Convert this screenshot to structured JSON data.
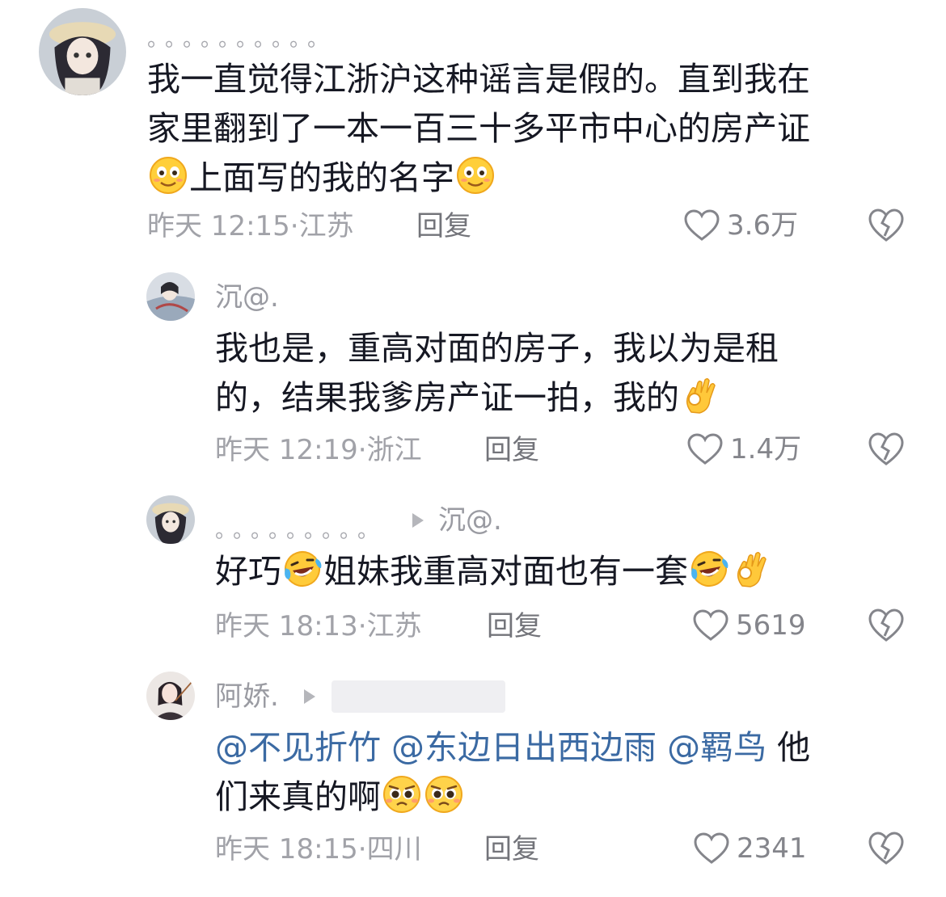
{
  "comments": [
    {
      "username": "。。。。。。。。。。",
      "lines": [
        "我一直觉得江浙沪这种谣言是假的。直到我在",
        "家里翻到了一本一百三十多平市中心的房产证",
        "上面写的我的名字"
      ],
      "emojis": [
        "smiling-face-emoji",
        "smiling-face-emoji"
      ],
      "time": "昨天 12:15·",
      "location": "江苏",
      "reply_label": "回复",
      "likes": "3.6万"
    },
    {
      "username": "沉@.",
      "lines": [
        "我也是，重高对面的房子，我以为是租",
        "的，结果我爹房产证一拍，我的"
      ],
      "emojis": [
        "ok-hand-emoji"
      ],
      "time": "昨天 12:19·",
      "location": "浙江",
      "reply_label": "回复",
      "likes": "1.4万"
    },
    {
      "username": "。。。。。。。。。",
      "reply_to": "沉@.",
      "text_a": "好巧",
      "text_b": "姐妹我重高对面也有一套",
      "emojis": [
        "laughing-tears-emoji",
        "laughing-tears-emoji",
        "ok-hand-emoji"
      ],
      "time": "昨天 18:13·",
      "location": "江苏",
      "reply_label": "回复",
      "likes": "5619"
    },
    {
      "username": "阿娇.",
      "mentions": [
        "@不见折竹",
        "@东边日出西边雨",
        "@羁鸟"
      ],
      "text_a": "他",
      "text_b": "们来真的啊",
      "emojis": [
        "pleading-face-emoji",
        "pleading-face-emoji"
      ],
      "time": "昨天 18:15·",
      "location": "四川",
      "reply_label": "回复",
      "likes": "2341"
    }
  ],
  "colors": {
    "text": "#161823",
    "meta": "#a1a2a8",
    "mention": "#3b6aa3",
    "icon": "#84858b"
  }
}
